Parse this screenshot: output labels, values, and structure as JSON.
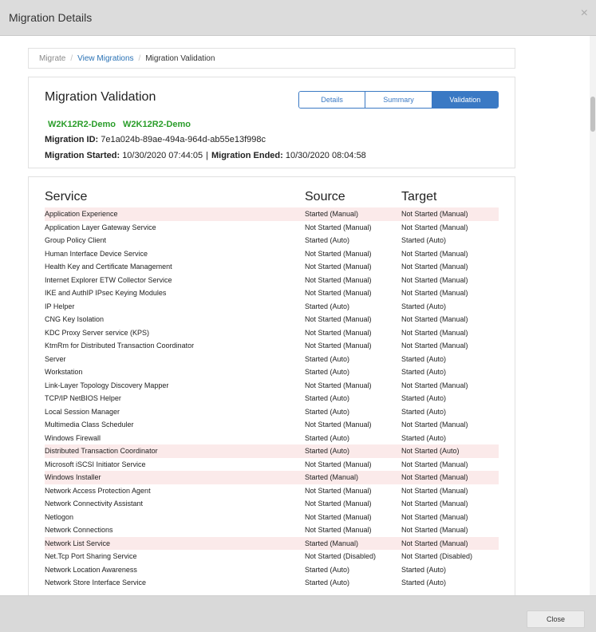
{
  "modal": {
    "title": "Migration Details",
    "close_icon": "×"
  },
  "breadcrumb": {
    "items": [
      "Migrate",
      "View Migrations",
      "Migration Validation"
    ],
    "separator": "/"
  },
  "card": {
    "title": "Migration Validation",
    "tabs": [
      "Details",
      "Summary",
      "Validation"
    ],
    "active_tab": "Validation",
    "hosts": [
      "W2K12R2-Demo",
      "W2K12R2-Demo"
    ],
    "migration_id_label": "Migration ID:",
    "migration_id": "7e1a024b-89ae-494a-964d-ab55e13f998c",
    "started_label": "Migration Started:",
    "started_value": "10/30/2020 07:44:05",
    "pipe": "|",
    "ended_label": "Migration Ended:",
    "ended_value": "10/30/2020 08:04:58"
  },
  "table": {
    "headers": [
      "Service",
      "Source",
      "Target"
    ],
    "rows": [
      {
        "service": "Application Experience",
        "source": "Started (Manual)",
        "target": "Not Started (Manual)",
        "mismatch": true
      },
      {
        "service": "Application Layer Gateway Service",
        "source": "Not Started (Manual)",
        "target": "Not Started (Manual)",
        "mismatch": false
      },
      {
        "service": "Group Policy Client",
        "source": "Started (Auto)",
        "target": "Started (Auto)",
        "mismatch": false
      },
      {
        "service": "Human Interface Device Service",
        "source": "Not Started (Manual)",
        "target": "Not Started (Manual)",
        "mismatch": false
      },
      {
        "service": "Health Key and Certificate Management",
        "source": "Not Started (Manual)",
        "target": "Not Started (Manual)",
        "mismatch": false
      },
      {
        "service": "Internet Explorer ETW Collector Service",
        "source": "Not Started (Manual)",
        "target": "Not Started (Manual)",
        "mismatch": false
      },
      {
        "service": "IKE and AuthIP IPsec Keying Modules",
        "source": "Not Started (Manual)",
        "target": "Not Started (Manual)",
        "mismatch": false
      },
      {
        "service": "IP Helper",
        "source": "Started (Auto)",
        "target": "Started (Auto)",
        "mismatch": false
      },
      {
        "service": "CNG Key Isolation",
        "source": "Not Started (Manual)",
        "target": "Not Started (Manual)",
        "mismatch": false
      },
      {
        "service": "KDC Proxy Server service (KPS)",
        "source": "Not Started (Manual)",
        "target": "Not Started (Manual)",
        "mismatch": false
      },
      {
        "service": "KtmRm for Distributed Transaction Coordinator",
        "source": "Not Started (Manual)",
        "target": "Not Started (Manual)",
        "mismatch": false
      },
      {
        "service": "Server",
        "source": "Started (Auto)",
        "target": "Started (Auto)",
        "mismatch": false
      },
      {
        "service": "Workstation",
        "source": "Started (Auto)",
        "target": "Started (Auto)",
        "mismatch": false
      },
      {
        "service": "Link-Layer Topology Discovery Mapper",
        "source": "Not Started (Manual)",
        "target": "Not Started (Manual)",
        "mismatch": false
      },
      {
        "service": "TCP/IP NetBIOS Helper",
        "source": "Started (Auto)",
        "target": "Started (Auto)",
        "mismatch": false
      },
      {
        "service": "Local Session Manager",
        "source": "Started (Auto)",
        "target": "Started (Auto)",
        "mismatch": false
      },
      {
        "service": "Multimedia Class Scheduler",
        "source": "Not Started (Manual)",
        "target": "Not Started (Manual)",
        "mismatch": false
      },
      {
        "service": "Windows Firewall",
        "source": "Started (Auto)",
        "target": "Started (Auto)",
        "mismatch": false
      },
      {
        "service": "Distributed Transaction Coordinator",
        "source": "Started (Auto)",
        "target": "Not Started (Auto)",
        "mismatch": true
      },
      {
        "service": "Microsoft iSCSI Initiator Service",
        "source": "Not Started (Manual)",
        "target": "Not Started (Manual)",
        "mismatch": false
      },
      {
        "service": "Windows Installer",
        "source": "Started (Manual)",
        "target": "Not Started (Manual)",
        "mismatch": true
      },
      {
        "service": "Network Access Protection Agent",
        "source": "Not Started (Manual)",
        "target": "Not Started (Manual)",
        "mismatch": false
      },
      {
        "service": "Network Connectivity Assistant",
        "source": "Not Started (Manual)",
        "target": "Not Started (Manual)",
        "mismatch": false
      },
      {
        "service": "Netlogon",
        "source": "Not Started (Manual)",
        "target": "Not Started (Manual)",
        "mismatch": false
      },
      {
        "service": "Network Connections",
        "source": "Not Started (Manual)",
        "target": "Not Started (Manual)",
        "mismatch": false
      },
      {
        "service": "Network List Service",
        "source": "Started (Manual)",
        "target": "Not Started (Manual)",
        "mismatch": true
      },
      {
        "service": "Net.Tcp Port Sharing Service",
        "source": "Not Started (Disabled)",
        "target": "Not Started (Disabled)",
        "mismatch": false
      },
      {
        "service": "Network Location Awareness",
        "source": "Started (Auto)",
        "target": "Started (Auto)",
        "mismatch": false
      },
      {
        "service": "Network Store Interface Service",
        "source": "Started (Auto)",
        "target": "Started (Auto)",
        "mismatch": false
      }
    ]
  },
  "footer": {
    "close_label": "Close"
  },
  "colors": {
    "accent": "#3a79c4",
    "host_green": "#2a9d2a",
    "mismatch_row": "#fbeaea",
    "link": "#2a72b5"
  }
}
